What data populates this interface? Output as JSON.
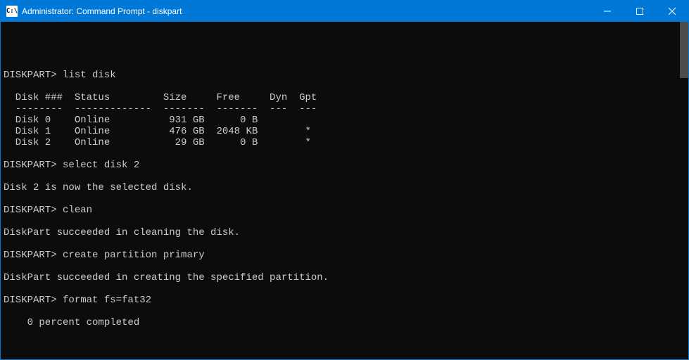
{
  "titlebar": {
    "icon_text": "C:\\",
    "title": "Administrator: Command Prompt - diskpart"
  },
  "terminal": {
    "lines": [
      "",
      "DISKPART> list disk",
      "",
      "  Disk ###  Status         Size     Free     Dyn  Gpt",
      "  --------  -------------  -------  -------  ---  ---",
      "  Disk 0    Online          931 GB      0 B",
      "  Disk 1    Online          476 GB  2048 KB        *",
      "  Disk 2    Online           29 GB      0 B        *",
      "",
      "DISKPART> select disk 2",
      "",
      "Disk 2 is now the selected disk.",
      "",
      "DISKPART> clean",
      "",
      "DiskPart succeeded in cleaning the disk.",
      "",
      "DISKPART> create partition primary",
      "",
      "DiskPart succeeded in creating the specified partition.",
      "",
      "DISKPART> format fs=fat32",
      "",
      "    0 percent completed"
    ]
  }
}
